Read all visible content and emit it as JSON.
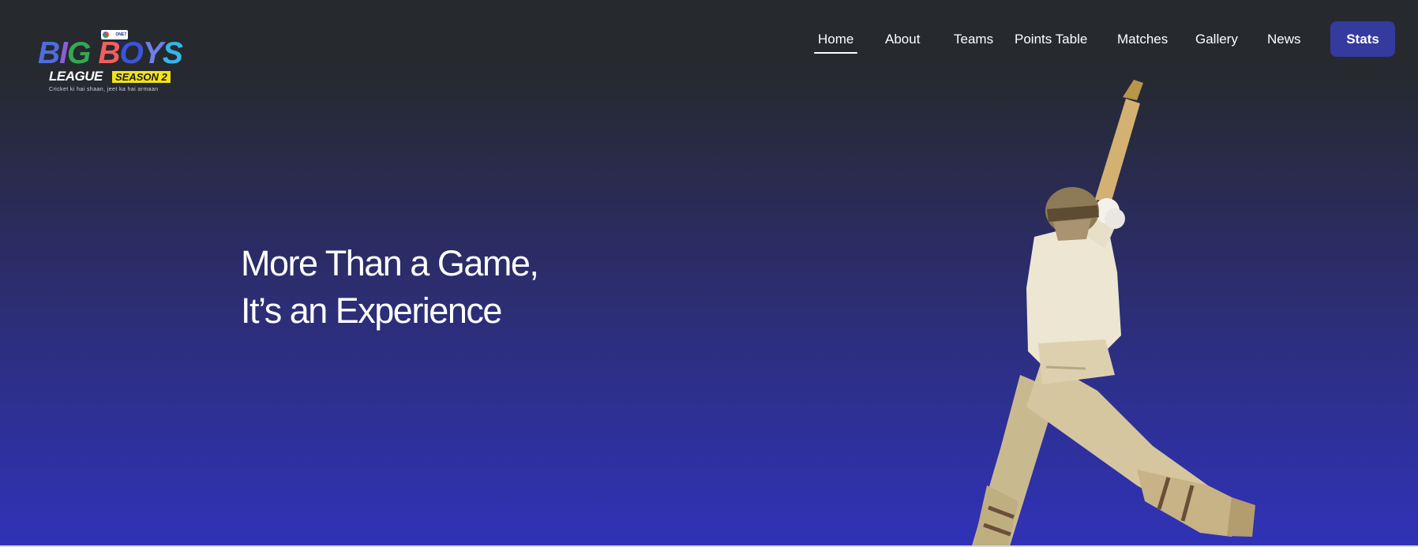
{
  "logo": {
    "badge_text": "ONE7 SPORTS",
    "main_letters": [
      "B",
      "I",
      "G",
      " ",
      "B",
      "O",
      "Y",
      "S"
    ],
    "league": "LEAGUE",
    "season": "SEASON 2",
    "tagline": "Cricket ki hai shaan, jeet ka hai armaan"
  },
  "nav": {
    "items": [
      {
        "label": "Home",
        "active": true
      },
      {
        "label": "About",
        "active": false
      },
      {
        "label": "Teams",
        "active": false
      },
      {
        "label": "Points Table",
        "active": false
      },
      {
        "label": "Matches",
        "active": false
      },
      {
        "label": "Gallery",
        "active": false
      },
      {
        "label": "News",
        "active": false
      }
    ],
    "cta_label": "Stats"
  },
  "hero": {
    "headline_line1": "More Than a Game,",
    "headline_line2": "It’s an Experience"
  },
  "colors": {
    "cta_bg": "#343a9e",
    "gradient_top": "#262a2f",
    "gradient_bottom": "#3032b8"
  }
}
